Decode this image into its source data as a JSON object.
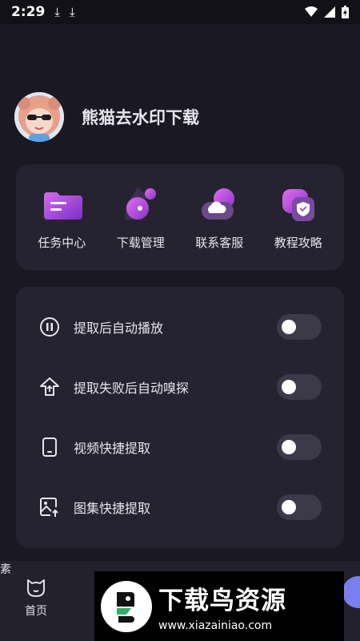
{
  "status_bar": {
    "time": "2:29",
    "download_icon_1": "⤓",
    "download_icon_2": "⤓"
  },
  "profile": {
    "username": "熊猫去水印下载"
  },
  "quick_actions": [
    {
      "label": "任务中心",
      "icon": "task-center-icon"
    },
    {
      "label": "下载管理",
      "icon": "download-manage-icon"
    },
    {
      "label": "联系客服",
      "icon": "customer-service-icon"
    },
    {
      "label": "教程攻略",
      "icon": "tutorial-icon"
    }
  ],
  "settings": [
    {
      "label": "提取后自动播放",
      "icon": "auto-play-icon",
      "enabled": false
    },
    {
      "label": "提取失败后自动嗅探",
      "icon": "auto-sniff-icon",
      "enabled": false
    },
    {
      "label": "视频快捷提取",
      "icon": "video-quick-icon",
      "enabled": false
    },
    {
      "label": "图集快捷提取",
      "icon": "image-quick-icon",
      "enabled": false
    }
  ],
  "bottom_nav": {
    "home_label": "首页",
    "second_label_partial": "素"
  },
  "watermark": {
    "title": "下载鸟资源",
    "url": "www.xiazainiao.com"
  },
  "colors": {
    "background": "#1a1823",
    "card": "#262330",
    "accent_purple": "#b44ee6",
    "toggle_off": "#3c3948"
  }
}
